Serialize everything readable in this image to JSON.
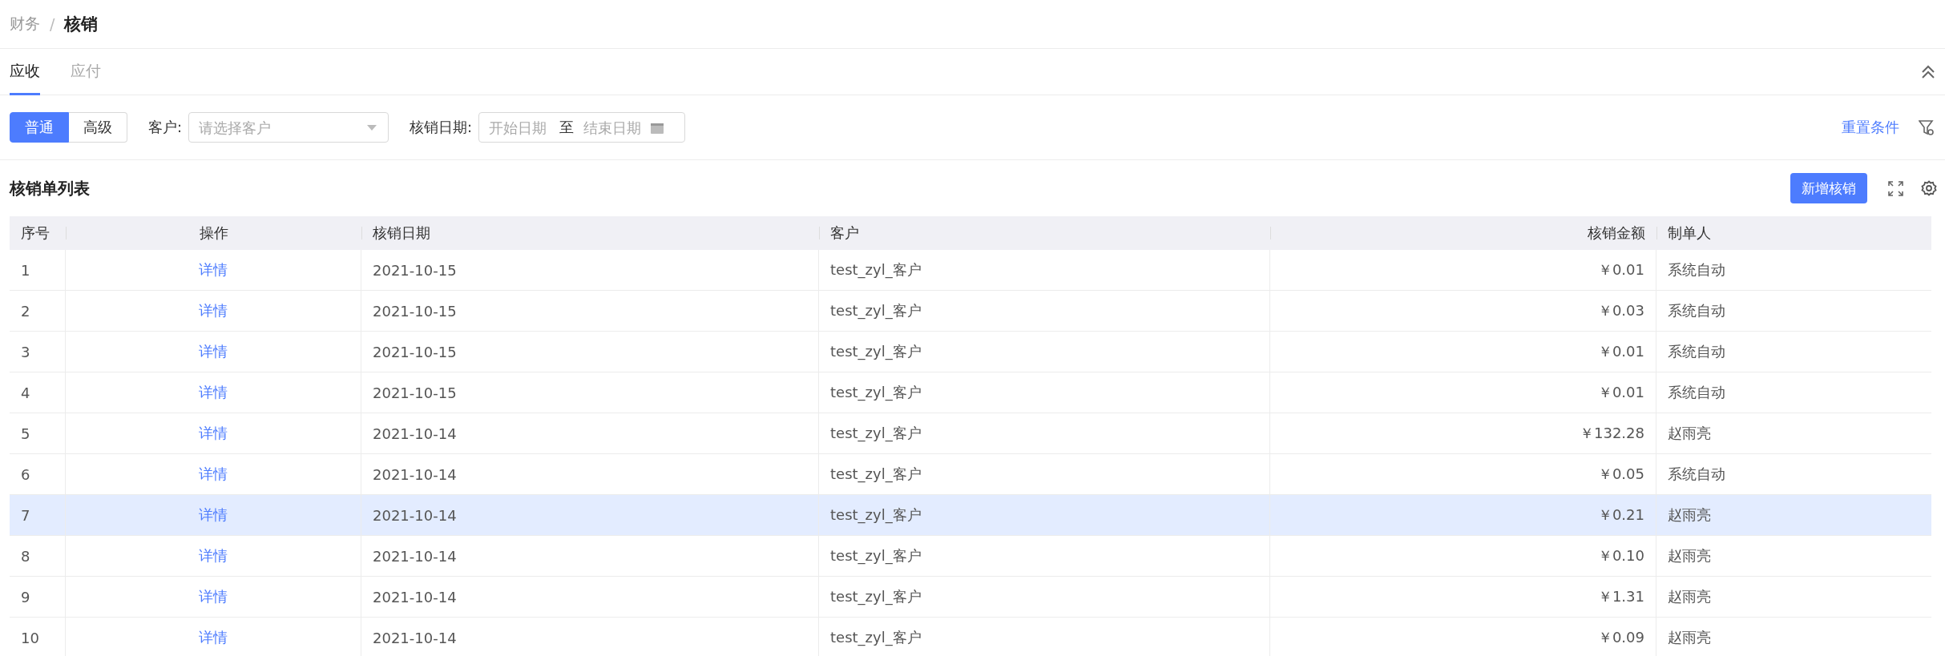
{
  "breadcrumb": {
    "items": [
      {
        "label": "财务",
        "current": false
      },
      {
        "label": "核销",
        "current": true
      }
    ],
    "separator": "/"
  },
  "tabs": [
    {
      "label": "应收",
      "selected": true
    },
    {
      "label": "应付",
      "selected": false
    }
  ],
  "filter": {
    "modes": [
      {
        "label": "普通",
        "selected": true
      },
      {
        "label": "高级",
        "selected": false
      }
    ],
    "customer": {
      "label": "客户:",
      "placeholder": "请选择客户"
    },
    "date": {
      "label": "核销日期:",
      "start_placeholder": "开始日期",
      "separator": "至",
      "end_placeholder": "结束日期"
    },
    "reset_link": "重置条件"
  },
  "list": {
    "title": "核销单列表",
    "add_button": "新增核销"
  },
  "table": {
    "columns": [
      "序号",
      "操作",
      "核销日期",
      "客户",
      "核销金额",
      "制单人"
    ],
    "rows": [
      {
        "cells": [
          "1",
          "详情",
          "2021-10-15",
          "test_zyl_客户",
          "￥0.01",
          "系统自动"
        ],
        "selected": false
      },
      {
        "cells": [
          "2",
          "详情",
          "2021-10-15",
          "test_zyl_客户",
          "￥0.03",
          "系统自动"
        ],
        "selected": false
      },
      {
        "cells": [
          "3",
          "详情",
          "2021-10-15",
          "test_zyl_客户",
          "￥0.01",
          "系统自动"
        ],
        "selected": false
      },
      {
        "cells": [
          "4",
          "详情",
          "2021-10-15",
          "test_zyl_客户",
          "￥0.01",
          "系统自动"
        ],
        "selected": false
      },
      {
        "cells": [
          "5",
          "详情",
          "2021-10-14",
          "test_zyl_客户",
          "￥132.28",
          "赵雨亮"
        ],
        "selected": false
      },
      {
        "cells": [
          "6",
          "详情",
          "2021-10-14",
          "test_zyl_客户",
          "￥0.05",
          "系统自动"
        ],
        "selected": false
      },
      {
        "cells": [
          "7",
          "详情",
          "2021-10-14",
          "test_zyl_客户",
          "￥0.21",
          "赵雨亮"
        ],
        "selected": true
      },
      {
        "cells": [
          "8",
          "详情",
          "2021-10-14",
          "test_zyl_客户",
          "￥0.10",
          "赵雨亮"
        ],
        "selected": false
      },
      {
        "cells": [
          "9",
          "详情",
          "2021-10-14",
          "test_zyl_客户",
          "￥1.31",
          "赵雨亮"
        ],
        "selected": false
      },
      {
        "cells": [
          "10",
          "详情",
          "2021-10-14",
          "test_zyl_客户",
          "￥0.09",
          "赵雨亮"
        ],
        "selected": false
      }
    ]
  }
}
